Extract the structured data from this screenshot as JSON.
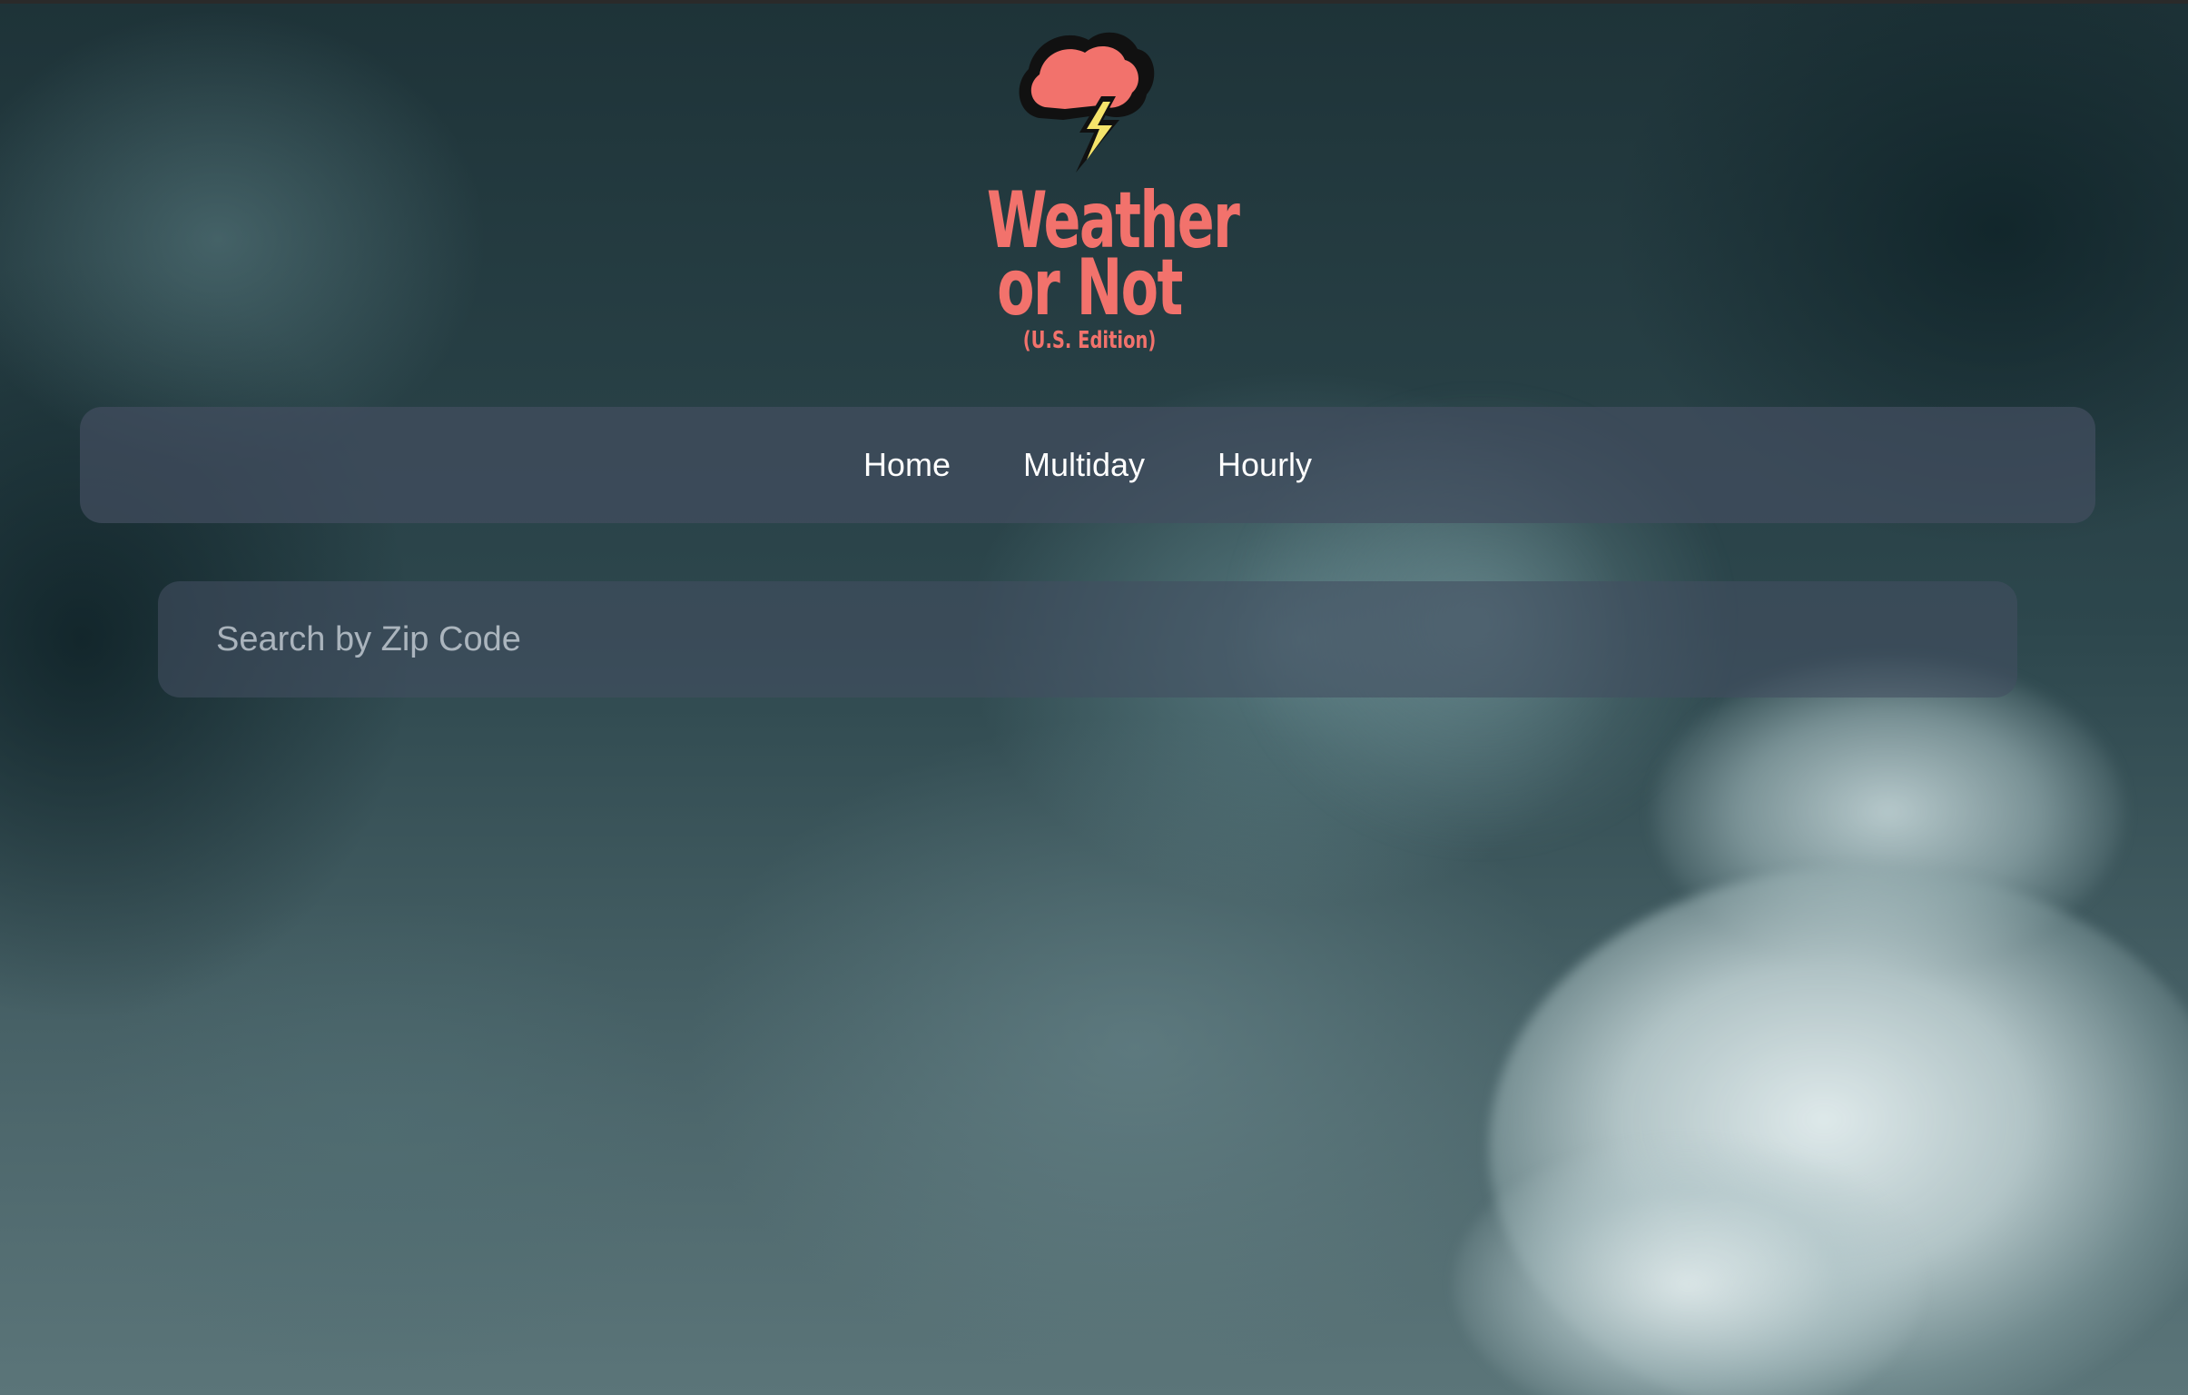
{
  "logo": {
    "title_line1": "Weather",
    "title_line2": "or Not",
    "subtitle": "(U.S. Edition)",
    "icon": "storm-cloud-lightning-icon",
    "colors": {
      "brand": "#f2726c",
      "cloud": "#f2726c",
      "bolt": "#f5e46b",
      "outline": "#111111"
    }
  },
  "nav": {
    "items": [
      {
        "label": "Home"
      },
      {
        "label": "Multiday"
      },
      {
        "label": "Hourly"
      }
    ]
  },
  "search": {
    "placeholder": "Search by Zip Code",
    "value": ""
  }
}
